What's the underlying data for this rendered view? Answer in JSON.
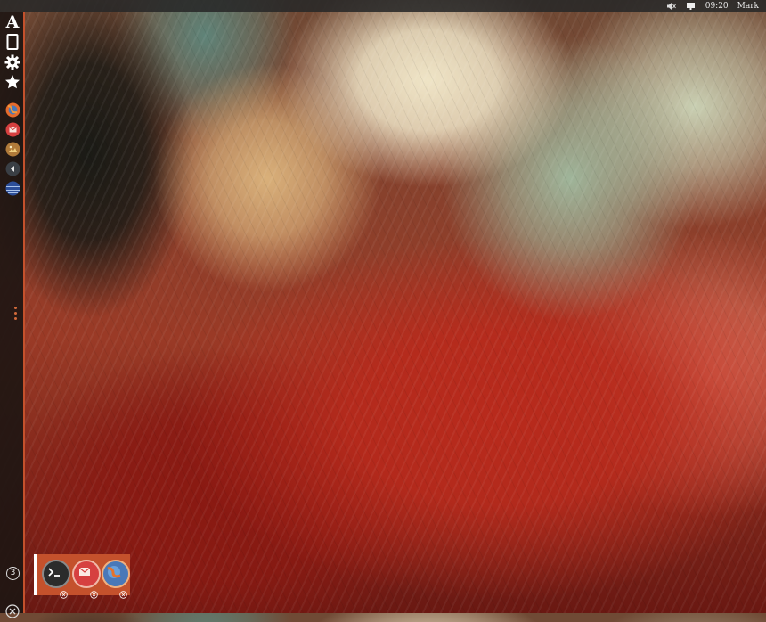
{
  "top_panel": {
    "tray": {
      "volume_icon": "volume-muted-icon",
      "display_icon": "display-icon",
      "clock": "09:20",
      "user": "Mark"
    }
  },
  "dock": {
    "launchers": [
      "text-editor-icon",
      "tablet-icon",
      "settings-gear-icon",
      "favorites-star-icon"
    ],
    "apps": [
      "firefox-icon",
      "mail-icon",
      "image-viewer-icon",
      "media-player-icon",
      "globe-icon"
    ],
    "workspace_number": "3",
    "close_icon": "close-icon"
  },
  "task_switcher": {
    "tasks": [
      "terminal-icon",
      "mail-icon",
      "firefox-icon"
    ]
  },
  "colors": {
    "accent": "#c4512c",
    "panel": "#282828",
    "dock": "#1e1612"
  }
}
